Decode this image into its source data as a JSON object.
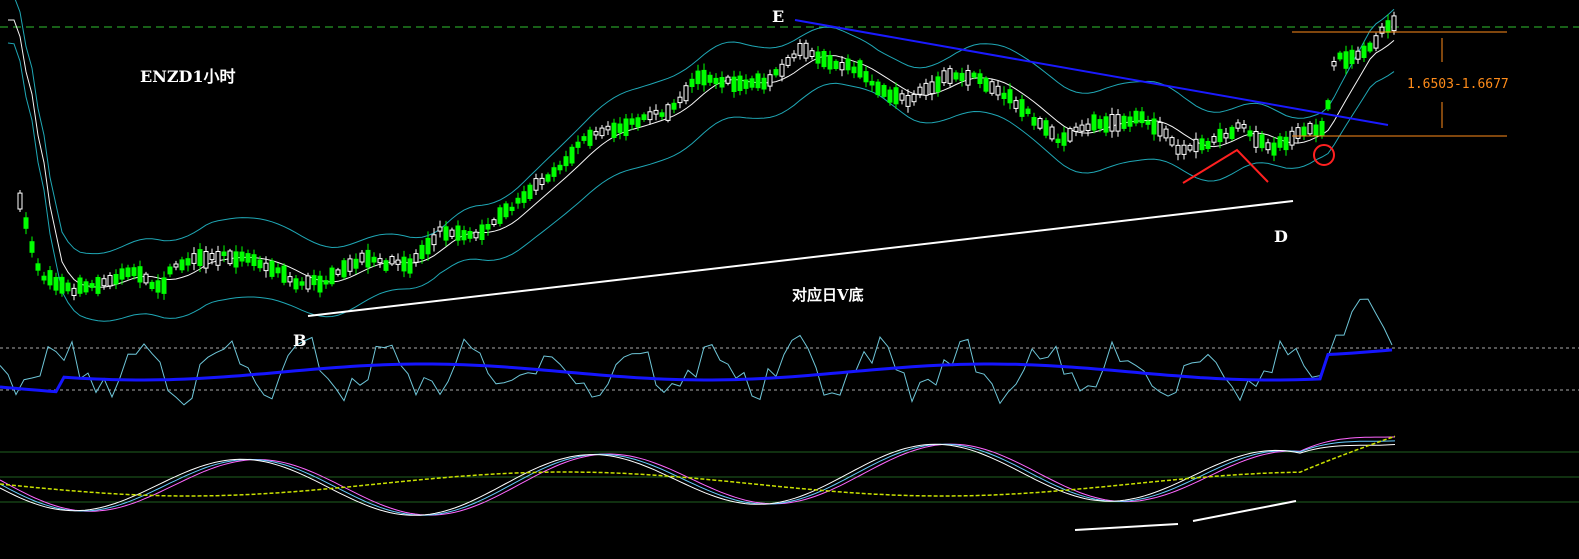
{
  "chart_title": "ENZD1小时",
  "caption": "对应日V底",
  "range_label": "1.6503-1.6677",
  "point_labels": {
    "E": "E",
    "D": "D",
    "B": "B"
  },
  "colors": {
    "background": "#000000",
    "bull_candle": "#00ff00",
    "bear_candle": "#ffffff",
    "bollinger": "#1fa7b5",
    "moving_avg": "#f5f5f5",
    "downtrend": "#1a1aff",
    "uptrend": "#ffffff",
    "v_bottom": "#ff2020",
    "range_marker": "#ff8c1a",
    "rsi_fast": "#6ec6d8",
    "rsi_slow": "#1515ff",
    "grid": "#1a3a1a"
  },
  "chart_data": [
    {
      "type": "candlestick",
      "title": "ENZD1小时",
      "annotations": [
        "E",
        "D",
        "B",
        "对应日V底",
        "1.6503-1.6677"
      ],
      "lines": [
        "downtrend from E",
        "uptrend from B to D",
        "V bottom"
      ],
      "grid": true
    },
    {
      "type": "line",
      "series": [
        {
          "name": "",
          "role": "oscillator"
        },
        {
          "name": "",
          "role": "signal"
        }
      ],
      "grid": false
    },
    {
      "type": "line",
      "series": [
        {
          "name": "",
          "role": "stochastic"
        }
      ],
      "grid": true
    }
  ]
}
